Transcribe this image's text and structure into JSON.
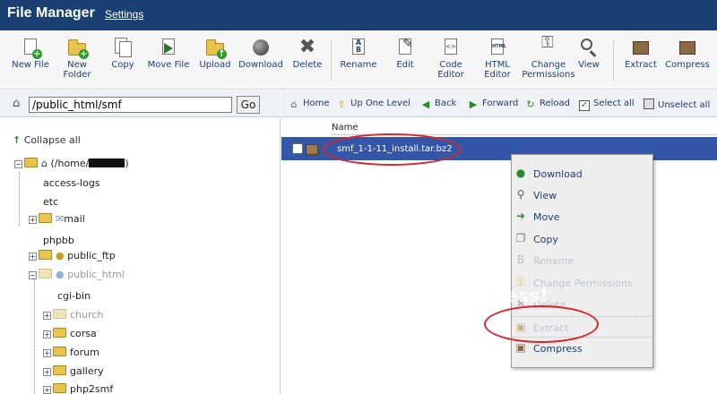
{
  "header": {
    "title": "File Manager",
    "settings": "Settings"
  },
  "toolbar": {
    "buttons": [
      {
        "label": "New File",
        "icon": "new-file-icon"
      },
      {
        "label": "New Folder",
        "icon": "new-folder-icon"
      },
      {
        "label": "Copy",
        "icon": "copy-icon"
      },
      {
        "label": "Move File",
        "icon": "move-file-icon"
      },
      {
        "label": "Upload",
        "icon": "upload-icon"
      },
      {
        "label": "Download",
        "icon": "download-icon"
      },
      {
        "label": "Delete",
        "icon": "delete-icon"
      },
      {
        "label": "Rename",
        "icon": "rename-icon"
      },
      {
        "label": "Edit",
        "icon": "edit-icon"
      },
      {
        "label": "Code Editor",
        "icon": "code-editor-icon"
      },
      {
        "label": "HTML Editor",
        "icon": "html-editor-icon"
      },
      {
        "label": "Change Permissions",
        "icon": "change-permissions-icon"
      },
      {
        "label": "View",
        "icon": "view-icon"
      },
      {
        "label": "Extract",
        "icon": "extract-icon"
      },
      {
        "label": "Compress",
        "icon": "compress-icon"
      }
    ]
  },
  "pathbar": {
    "path": "/public_html/smf",
    "go": "Go"
  },
  "nav": {
    "home": "Home",
    "up": "Up One Level",
    "back": "Back",
    "forward": "Forward",
    "reload": "Reload",
    "select_all": "Select all",
    "unselect_all": "Unselect all"
  },
  "tree": {
    "collapse_all": "Collapse all",
    "root": "(/home/",
    "items": [
      "access-logs",
      "etc",
      "mail",
      "phpbb",
      "public_ftp",
      "public_html",
      "cgi-bin",
      "church",
      "corsa",
      "forum",
      "gallery",
      "php2smf"
    ]
  },
  "files": {
    "header": "Name",
    "rows": [
      {
        "name": "smf_1-1-11_install.tar.bz2"
      }
    ]
  },
  "context_menu": {
    "items": [
      "Download",
      "View",
      "Move",
      "Copy",
      "Rename",
      "Change Permissions",
      "Delete",
      "Extract",
      "Compress"
    ]
  },
  "watermark": "ess!",
  "colors": {
    "header_bg": "#1a3f73",
    "selection": "#3356a9",
    "annotation": "#d9262a"
  }
}
